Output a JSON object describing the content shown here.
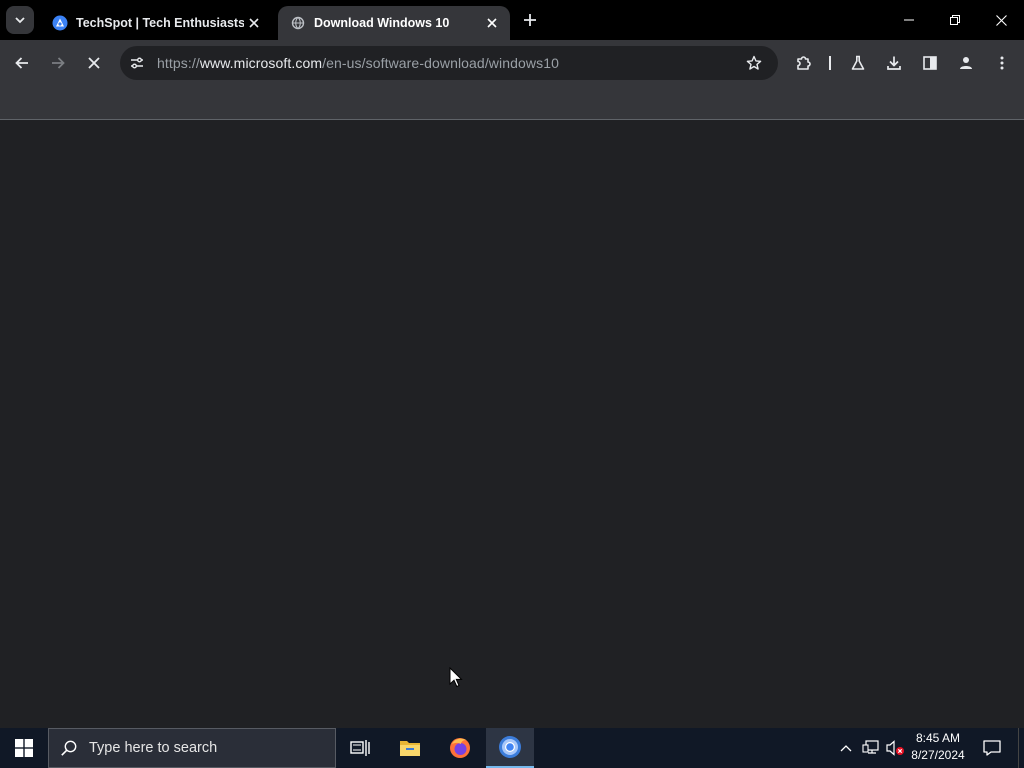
{
  "browser": {
    "tabs": [
      {
        "title": "TechSpot | Tech Enthusiasts, Power Users, Gamers",
        "state": "inactive",
        "favicon": "techspot-favicon"
      },
      {
        "title": "Download Windows 10",
        "state": "active",
        "favicon": "loading-globe-favicon"
      }
    ],
    "address": {
      "scheme": "https://",
      "host": "www.microsoft.com",
      "path": "/en-us/software-download/windows10"
    },
    "page_state": "loading"
  },
  "taskbar": {
    "search_placeholder": "Type here to search",
    "apps": [
      "task-view",
      "file-explorer",
      "firefox",
      "chrome"
    ],
    "active_app": "chrome",
    "clock": {
      "time": "8:45 AM",
      "date": "8/27/2024"
    }
  },
  "colors": {
    "accent": "#76b9ed",
    "tabstrip_bg": "#000000",
    "toolbar_bg": "#35363a",
    "content_bg": "#202124",
    "taskbar_bg": "#101826"
  }
}
